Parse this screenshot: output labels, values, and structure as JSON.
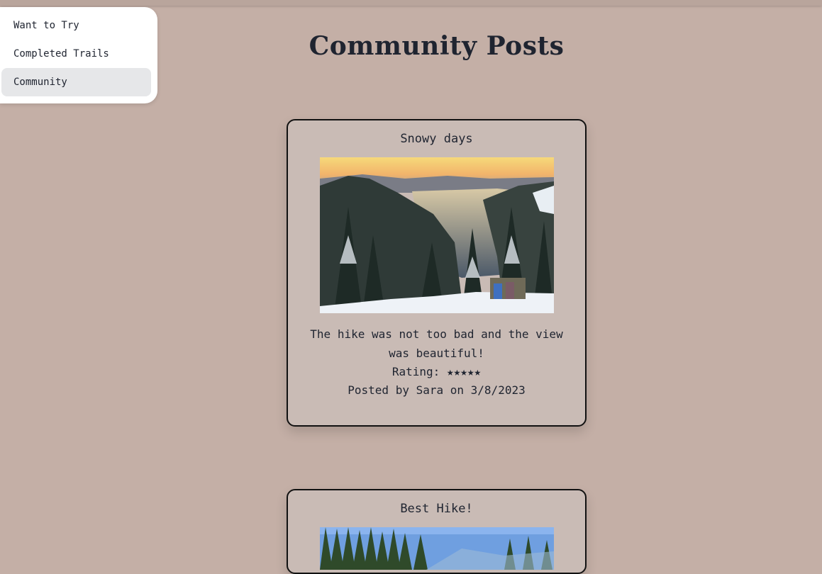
{
  "sidebar": {
    "items": [
      {
        "label": "Want to Try"
      },
      {
        "label": "Completed Trails"
      },
      {
        "label": "Community"
      }
    ]
  },
  "page": {
    "title": "Community Posts"
  },
  "posts": [
    {
      "title": "Snowy days",
      "text": "The hike was not too bad and the view was beautiful!",
      "rating": "Rating: ★★★★★",
      "byline": "Posted by Sara on 3/8/2023"
    },
    {
      "title": "Best Hike!"
    }
  ],
  "colors": {
    "background": "#c4afa6",
    "card": "#c9bbb5",
    "active_nav": "#e6e7e9"
  }
}
